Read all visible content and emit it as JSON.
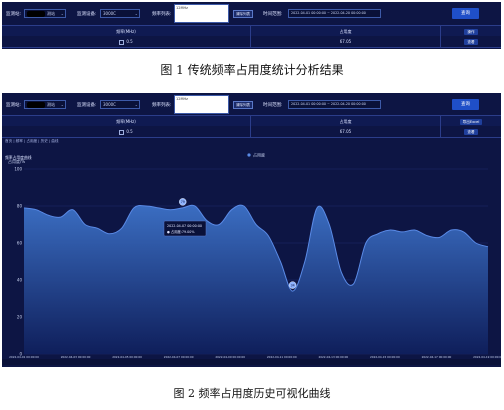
{
  "figure1": {
    "caption": "图 1 传统频率占用度统计分析结果",
    "filters": {
      "station_label": "监测站:",
      "station_suffix": "测站",
      "device_label": "监测设备:",
      "device_value": "3000C",
      "freq_list_label": "频率列表:",
      "freq_list_value": "12MHz",
      "freq_clear_button": "清除列表",
      "time_label": "时间范围:",
      "time_value": "2022-04-01 00:00:00 ~ 2022-04-20 00:00:00",
      "query_button": "查询"
    },
    "table": {
      "headers": [
        "频率(MHz)",
        "占用度",
        "操作"
      ],
      "rows": [
        {
          "freq": "0.5",
          "occupancy": "67.05",
          "action": "查看"
        }
      ]
    }
  },
  "figure2": {
    "caption": "图 2 频率占用度历史可视化曲线",
    "filters": {
      "station_label": "监测站:",
      "station_suffix": "测站",
      "device_label": "监测设备:",
      "device_value": "3000C",
      "freq_list_label": "频率列表:",
      "freq_list_value": "12MHz",
      "freq_clear_button": "清除列表",
      "time_label": "时间范围:",
      "time_value": "2022-04-01 00:00:00 ~ 2022-04-20 00:00:00",
      "query_button": "查询"
    },
    "table": {
      "headers": [
        "频率(MHz)",
        "占用度",
        "导出Excel"
      ],
      "rows": [
        {
          "freq": "0.5",
          "occupancy": "67.05",
          "action": "查看"
        }
      ]
    },
    "breadcrumb": "首页 | 频率 | 占用度 | 历史 | 曲线",
    "chart_title": "频率占用度曲线",
    "tooltip": {
      "date": "2022-04-07 00:00:00",
      "series_line": "● 占用度:79.00%"
    }
  },
  "chart_data": {
    "type": "area",
    "title": "频率占用度曲线",
    "ylabel": "占用度/%",
    "legend": [
      "占用度"
    ],
    "legend_position": "top-center",
    "ylim": [
      0,
      100
    ],
    "yticks": [
      0,
      20,
      40,
      60,
      80,
      100
    ],
    "grid": true,
    "xticklabels": [
      "2022-04-01 00:00:00",
      "2022-04-03 00:00:00",
      "2022-04-05 00:00:00",
      "2022-04-07 00:00:00",
      "2022-04-09 00:00:00",
      "2022-04-11 00:00:00",
      "2022-04-13 00:00:00",
      "2022-04-15 00:00:00",
      "2022-04-17 00:00:00",
      "2022-04-19 00:00:00"
    ],
    "series": [
      {
        "name": "占用度",
        "x": [
          0,
          0.5,
          1,
          1.5,
          2,
          2.5,
          3,
          3.5,
          4,
          4.5,
          5,
          5.5,
          6,
          6.5,
          7,
          7.5,
          8,
          8.5,
          9,
          9.5,
          10,
          10.5,
          11,
          11.5,
          12,
          12.5,
          13,
          13.5,
          14,
          14.5,
          15,
          15.5,
          16,
          16.5,
          17,
          17.5,
          18,
          18.5,
          19
        ],
        "values": [
          79,
          78,
          75,
          74,
          78,
          70,
          68,
          65,
          68,
          79,
          80,
          79,
          78,
          79,
          80,
          72,
          70,
          78,
          80,
          70,
          64,
          50,
          34,
          50,
          79,
          70,
          44,
          38,
          60,
          65,
          67,
          66,
          67,
          64,
          63,
          67,
          66,
          60,
          58
        ]
      }
    ],
    "markers": [
      {
        "x": 6.5,
        "value": 79,
        "label": "79"
      },
      {
        "x": 11,
        "value": 34,
        "label": "34"
      }
    ],
    "colors": {
      "line": "#5a8ae6",
      "area_top": "#3d72c8",
      "area_bottom": "#0f1f5c",
      "background": "#0d1544"
    }
  }
}
